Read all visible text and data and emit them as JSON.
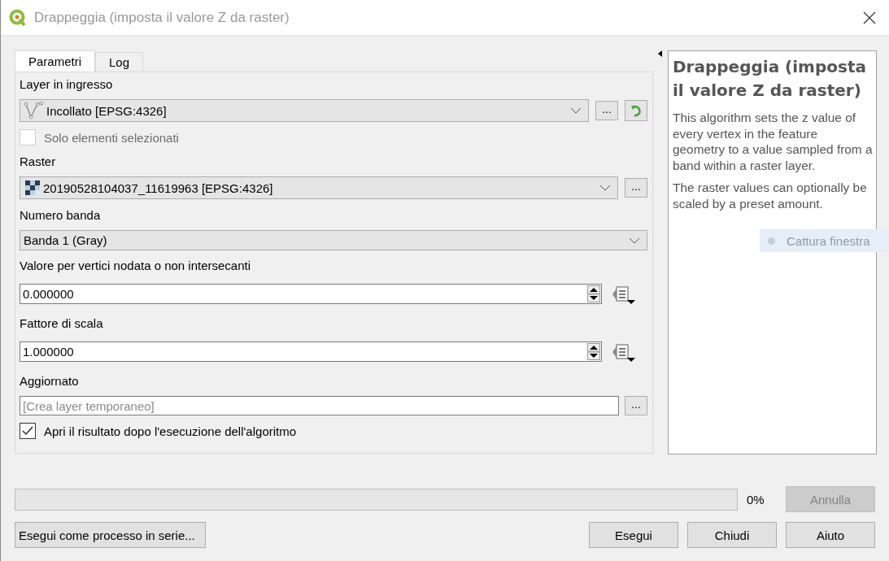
{
  "window": {
    "title": "Drappeggia (imposta il valore Z da raster)"
  },
  "tabs": [
    {
      "label": "Parametri",
      "selected": true
    },
    {
      "label": "Log",
      "selected": false
    }
  ],
  "parameters": [
    {
      "kind": "vector_layer",
      "label": "Layer in ingresso",
      "value": "Incollato [EPSG:4326]",
      "browse": "...",
      "refresh": true
    },
    {
      "kind": "checkbox",
      "label": "Solo elementi selezionati",
      "checked": false,
      "disabled": true
    },
    {
      "kind": "raster_layer",
      "label": "Raster",
      "value": "20190528104037_11619963 [EPSG:4326]",
      "browse": "..."
    },
    {
      "kind": "band",
      "label": "Numero banda",
      "value": "Banda 1 (Gray)"
    },
    {
      "kind": "spin",
      "label": "Valore per vertici nodata o non intersecanti",
      "value": "0.000000"
    },
    {
      "kind": "spin",
      "label": "Fattore di scala",
      "value": "1.000000"
    },
    {
      "kind": "output",
      "label": "Aggiornato",
      "placeholder": "[Crea layer temporaneo]",
      "browse": "..."
    },
    {
      "kind": "checkbox",
      "label": "Apri il risultato dopo l'esecuzione dell'algoritmo",
      "checked": true,
      "disabled": false
    }
  ],
  "help": {
    "title": "Drappeggia (imposta il valore Z da raster)",
    "paragraphs": [
      "This algorithm sets the z value of every vertex in the feature geometry to a value sampled from a band within a raster layer.",
      "The raster values can optionally be scaled by a preset amount."
    ]
  },
  "progress": {
    "level": 0,
    "reading": "0%"
  },
  "cancel_button": {
    "label": "Annulla",
    "disabled": true
  },
  "batch_button": {
    "label": "Esegui come processo in serie..."
  },
  "buttons": [
    {
      "label": "Esegui"
    },
    {
      "label": "Chiudi"
    },
    {
      "label": "Aiuto"
    }
  ],
  "capture_tooltip": {
    "text": "Cattura finestra"
  }
}
